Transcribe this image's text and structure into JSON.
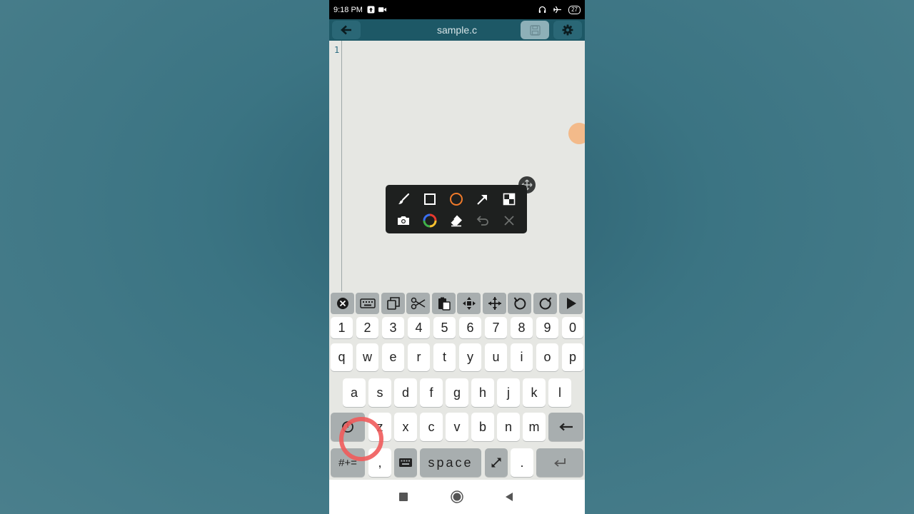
{
  "status_bar": {
    "time": "9:18 PM",
    "battery": "27"
  },
  "app_bar": {
    "title": "sample.c"
  },
  "editor": {
    "line_numbers": [
      "1"
    ]
  },
  "annotation_toolbar": {
    "tools_row1": [
      "brush-icon",
      "rectangle-icon",
      "circle-icon",
      "arrow-icon",
      "mosaic-icon"
    ],
    "tools_row2": [
      "camera-icon",
      "color-wheel-icon",
      "eraser-icon",
      "undo-icon",
      "close-icon"
    ],
    "accent": "#f07a2a"
  },
  "toolbar_keys": [
    "close-circle-icon",
    "keyboard-icon",
    "copy-icon",
    "cut-icon",
    "paste-icon",
    "move-cursor-icon",
    "select-move-icon",
    "undo-icon",
    "redo-icon",
    "run-icon"
  ],
  "keyboard": {
    "row_numbers": [
      "1",
      "2",
      "3",
      "4",
      "5",
      "6",
      "7",
      "8",
      "9",
      "0"
    ],
    "row_q": [
      "q",
      "w",
      "e",
      "r",
      "t",
      "y",
      "u",
      "i",
      "o",
      "p"
    ],
    "row_a": [
      "a",
      "s",
      "d",
      "f",
      "g",
      "h",
      "j",
      "k",
      "l"
    ],
    "row_z": [
      "z",
      "x",
      "c",
      "v",
      "b",
      "n",
      "m"
    ],
    "symbols_label": "#+=",
    "comma_label": ",",
    "space_label": "space",
    "period_label": "."
  },
  "colors": {
    "app_bar": "#1d5866",
    "editor_bg": "#e6e7e3",
    "key_gray": "#a8aeaf",
    "highlight_ring": "#ef5b5b"
  }
}
